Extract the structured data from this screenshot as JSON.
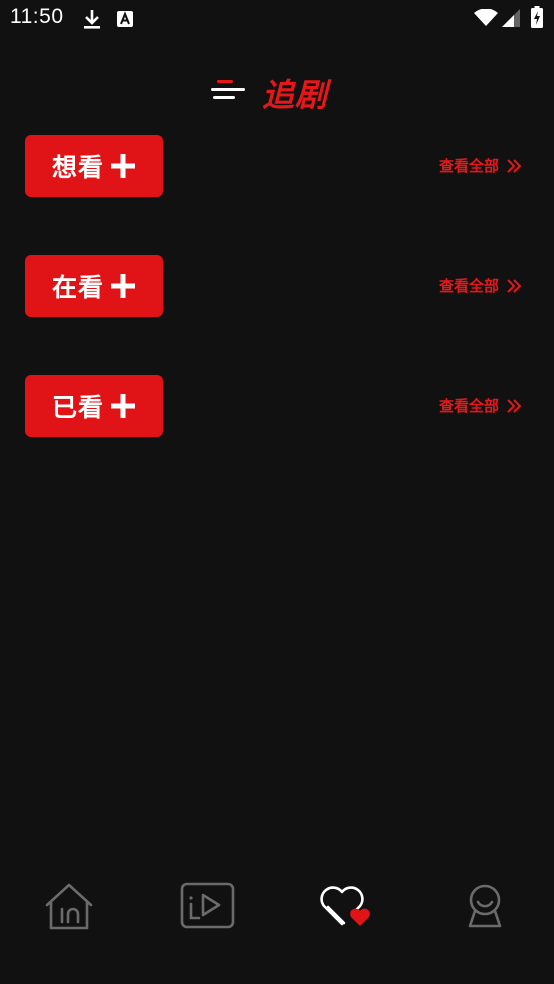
{
  "status_bar": {
    "time": "11:50",
    "icons": [
      "download-icon",
      "font-a-icon",
      "wifi-icon",
      "cellular-signal-icon",
      "battery-icon"
    ]
  },
  "header": {
    "title": "追剧",
    "menu_icon": "menu-lines-icon"
  },
  "sections": [
    {
      "label": "想看",
      "view_all": "查看全部"
    },
    {
      "label": "在看",
      "view_all": "查看全部"
    },
    {
      "label": "已看",
      "view_all": "查看全部"
    }
  ],
  "bottom_nav": {
    "items": [
      {
        "icon": "home-icon",
        "active": false
      },
      {
        "icon": "video-play-icon",
        "active": false
      },
      {
        "icon": "favorites-heart-icon",
        "active": true
      },
      {
        "icon": "profile-icon",
        "active": false
      }
    ]
  },
  "colors": {
    "background": "#121112",
    "accent": "#e01416",
    "text": "#ffffff",
    "nav_inactive": "#6b6b6b"
  }
}
